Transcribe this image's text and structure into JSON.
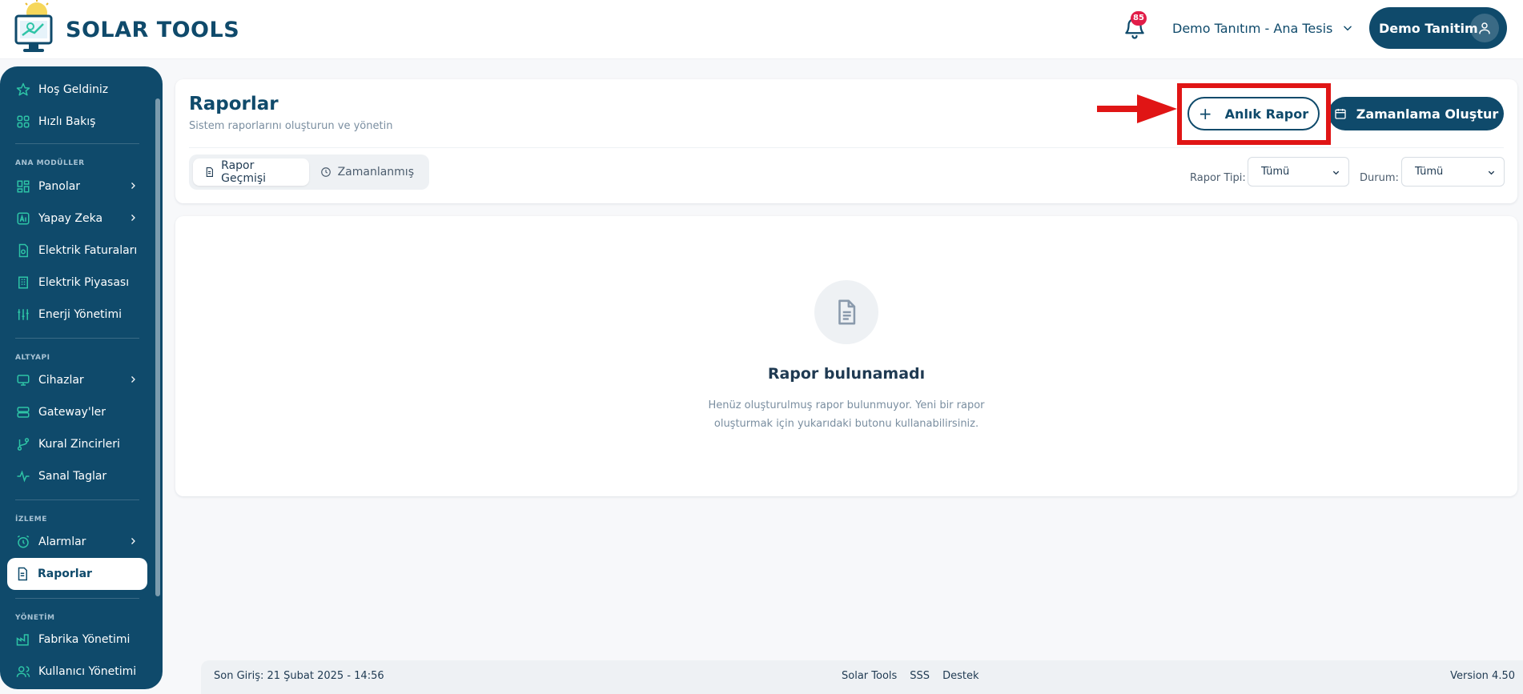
{
  "app": {
    "brand": "SOLAR TOOLS"
  },
  "header": {
    "notification_count": "85",
    "facility": "Demo Tanıtım - Ana Tesis",
    "user_name": "Demo Tanitim"
  },
  "sidebar": {
    "items_top": [
      {
        "label": "Hoş Geldiniz",
        "icon": "star-icon"
      },
      {
        "label": "Hızlı Bakış",
        "icon": "grid-icon"
      }
    ],
    "sections": [
      {
        "title": "ANA MODÜLLER"
      },
      {
        "title": "ALTYAPI"
      },
      {
        "title": "İZLEME"
      },
      {
        "title": "YÖNETİM"
      }
    ],
    "items": {
      "panolar": "Panolar",
      "yapay_zeka": "Yapay Zeka",
      "elektrik_faturalari": "Elektrik Faturaları",
      "elektrik_piyasasi": "Elektrik Piyasası",
      "enerji_yonetimi": "Enerji Yönetimi",
      "cihazlar": "Cihazlar",
      "gatewayler": "Gateway'ler",
      "kural_zincirleri": "Kural Zincirleri",
      "sanal_taglar": "Sanal Taglar",
      "alarmlar": "Alarmlar",
      "raporlar": "Raporlar",
      "fabrika_yonetimi": "Fabrika Yönetimi",
      "kullanici_yonetimi": "Kullanıcı Yönetimi"
    }
  },
  "page": {
    "title": "Raporlar",
    "subtitle": "Sistem raporlarını oluşturun ve yönetin",
    "btn_instant": "Anlık Rapor",
    "btn_schedule": "Zamanlama Oluştur",
    "tabs": [
      {
        "label": "Rapor Geçmişi",
        "active": true
      },
      {
        "label": "Zamanlanmış",
        "active": false
      }
    ],
    "filters": {
      "type_label": "Rapor Tipi:",
      "type_value": "Tümü",
      "status_label": "Durum:",
      "status_value": "Tümü"
    }
  },
  "empty": {
    "title": "Rapor bulunamadı",
    "line1": "Henüz oluşturulmuş rapor bulunmuyor. Yeni bir rapor",
    "line2": "oluşturmak için yukarıdaki butonu kullanabilirsiniz."
  },
  "footer": {
    "last_login": "Son Giriş: 21 Şubat 2025 - 14:56",
    "links": [
      "Solar Tools",
      "SSS",
      "Destek"
    ],
    "version": "Version 4.50"
  },
  "colors": {
    "primary": "#0f4a6b",
    "accent": "#2ec4a6",
    "highlight": "#e01515",
    "badge": "#e11d48"
  }
}
